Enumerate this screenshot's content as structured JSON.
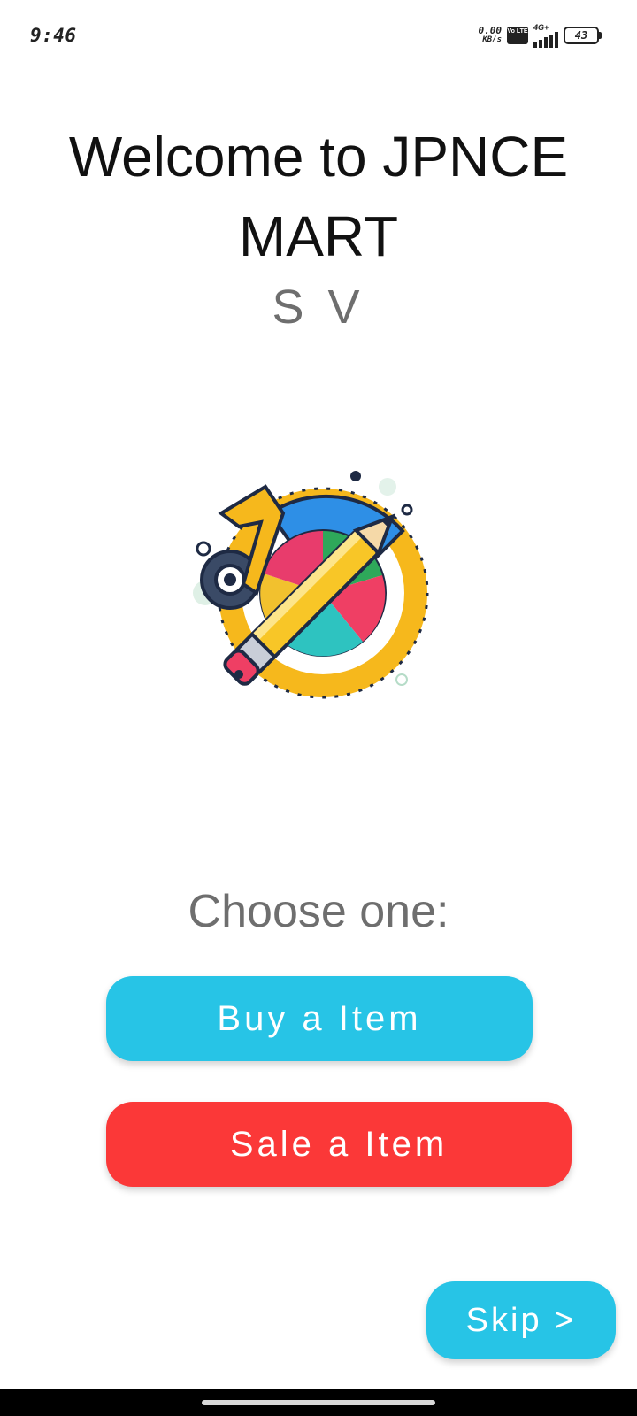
{
  "status_bar": {
    "time": "9:46",
    "net_speed_value": "0.00",
    "net_speed_unit": "KB/s",
    "volte_label": "Vo LTE",
    "network_type": "4G+",
    "battery_level": "43"
  },
  "welcome": {
    "title_line1": "Welcome to JPNCE",
    "title_line2": "MART",
    "subtitle": "S V"
  },
  "logo": {
    "icon": "stationery-tools-logo"
  },
  "choice": {
    "prompt": "Choose one:",
    "buy_label": "Buy a Item",
    "sell_label": "Sale a Item"
  },
  "skip_label": "Skip >",
  "colors": {
    "accent_blue": "#27c4e6",
    "accent_red": "#fb3838",
    "subtle_gray": "#6e6e6e"
  }
}
